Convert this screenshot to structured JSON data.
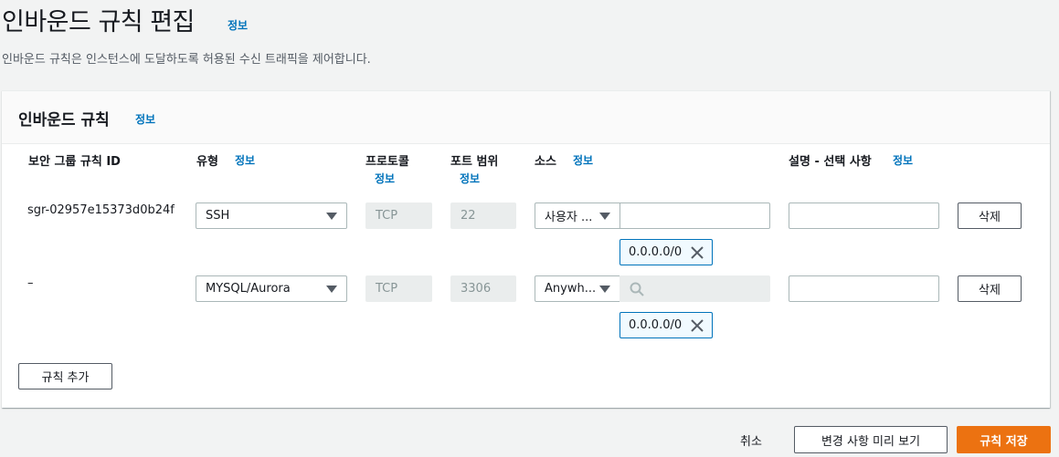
{
  "page": {
    "title": "인바운드 규칙 편집",
    "title_info": "정보",
    "description": "인바운드 규칙은 인스턴스에 도달하도록 허용된 수신 트래픽을 제어합니다."
  },
  "panel": {
    "title": "인바운드 규칙",
    "title_info": "정보",
    "columns": {
      "rule_id": "보안 그룹 규칙 ID",
      "type": "유형",
      "type_info": "정보",
      "protocol": "프로토콜",
      "protocol_info": "정보",
      "port": "포트 범위",
      "port_info": "정보",
      "source": "소스",
      "source_info": "정보",
      "description": "설명 - 선택 사항",
      "description_info": "정보"
    },
    "rules": [
      {
        "id": "sgr-02957e15373d0b24f",
        "type": "SSH",
        "protocol": "TCP",
        "port": "22",
        "source_type": "사용자 ...",
        "source_token": "0.0.0.0/0",
        "description": "",
        "delete_label": "삭제"
      },
      {
        "id": "–",
        "type": "MYSQL/Aurora",
        "protocol": "TCP",
        "port": "3306",
        "source_type": "Anywh...",
        "source_token": "0.0.0.0/0",
        "description": "",
        "delete_label": "삭제"
      }
    ],
    "add_rule_label": "규칙 추가"
  },
  "footer": {
    "cancel_label": "취소",
    "preview_label": "변경 사항 미리 보기",
    "save_label": "규칙 저장"
  },
  "colors": {
    "primary": "#ec7211",
    "link": "#0073bb",
    "token_border": "#0073bb"
  }
}
